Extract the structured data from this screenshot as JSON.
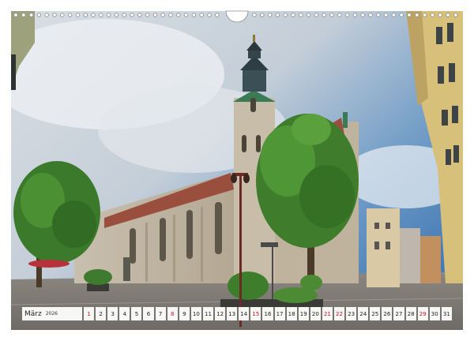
{
  "calendar": {
    "month": "März",
    "year": "2026",
    "days": [
      "1",
      "2",
      "3",
      "4",
      "5",
      "6",
      "7",
      "8",
      "9",
      "10",
      "11",
      "12",
      "13",
      "14",
      "15",
      "16",
      "17",
      "18",
      "19",
      "20",
      "21",
      "22",
      "23",
      "24",
      "25",
      "26",
      "27",
      "28",
      "29",
      "30",
      "31"
    ],
    "highlighted_days": [
      "1",
      "8",
      "15",
      "21",
      "22",
      "29"
    ],
    "highlight_color": "#c8102e"
  },
  "photo": {
    "subject": "church-street-scene"
  }
}
